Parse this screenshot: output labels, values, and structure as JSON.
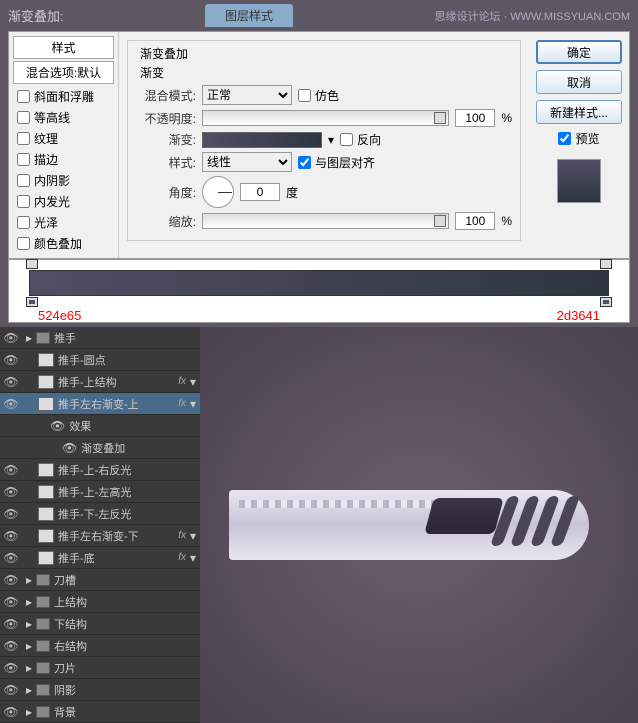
{
  "header": {
    "left": "渐变叠加:",
    "center": "图层样式",
    "right": "思缘设计论坛 · WWW.MISSYUAN.COM"
  },
  "styles": {
    "title": "样式",
    "blend_opts": "混合选项:默认",
    "items": [
      "斜面和浮雕",
      "等高线",
      "纹理",
      "描边",
      "内阴影",
      "内发光",
      "光泽",
      "颜色叠加"
    ]
  },
  "gradient": {
    "group_title": "渐变叠加",
    "sub_title": "渐变",
    "blend_label": "混合模式:",
    "blend_value": "正常",
    "dither": "仿色",
    "opacity_label": "不透明度:",
    "opacity_value": "100",
    "pct": "%",
    "grad_label": "渐变:",
    "reverse": "反向",
    "style_label": "样式:",
    "style_value": "线性",
    "align": "与图层对齐",
    "angle_label": "角度:",
    "angle_value": "0",
    "deg": "度",
    "scale_label": "缩放:",
    "scale_value": "100"
  },
  "buttons": {
    "ok": "确定",
    "cancel": "取消",
    "new": "新建样式...",
    "preview": "预览"
  },
  "stops": {
    "left": "524e65",
    "right": "2d3641"
  },
  "layers": [
    {
      "type": "folder",
      "name": "推手",
      "indent": 0
    },
    {
      "type": "layer",
      "name": "推手-圆点",
      "indent": 1
    },
    {
      "type": "layer",
      "name": "推手-上结构",
      "indent": 1,
      "fx": true
    },
    {
      "type": "layer",
      "name": "推手左右渐变-上",
      "indent": 1,
      "fx": true,
      "sel": true
    },
    {
      "type": "fx",
      "name": "效果",
      "indent": 2
    },
    {
      "type": "fx",
      "name": "渐变叠加",
      "indent": 3
    },
    {
      "type": "layer",
      "name": "推手-上-右反光",
      "indent": 1
    },
    {
      "type": "layer",
      "name": "推手-上-左高光",
      "indent": 1
    },
    {
      "type": "layer",
      "name": "推手-下-左反光",
      "indent": 1
    },
    {
      "type": "layer",
      "name": "推手左右渐变-下",
      "indent": 1,
      "fx": true
    },
    {
      "type": "layer",
      "name": "推手-底",
      "indent": 1,
      "fx": true
    },
    {
      "type": "folder",
      "name": "刀槽",
      "indent": 0
    },
    {
      "type": "folder",
      "name": "上结构",
      "indent": 0
    },
    {
      "type": "folder",
      "name": "下结构",
      "indent": 0
    },
    {
      "type": "folder",
      "name": "右结构",
      "indent": 0
    },
    {
      "type": "folder",
      "name": "刀片",
      "indent": 0
    },
    {
      "type": "folder",
      "name": "阴影",
      "indent": 0
    },
    {
      "type": "folder",
      "name": "背景",
      "indent": 0
    }
  ]
}
